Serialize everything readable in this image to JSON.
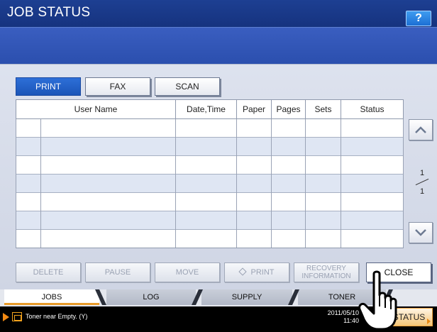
{
  "header": {
    "title": "JOB STATUS",
    "help_label": "?"
  },
  "tabs": [
    {
      "label": "PRINT",
      "active": true
    },
    {
      "label": "FAX",
      "active": false
    },
    {
      "label": "SCAN",
      "active": false
    }
  ],
  "table": {
    "columns": [
      "User Name",
      "Date,Time",
      "Paper",
      "Pages",
      "Sets",
      "Status"
    ],
    "rows": [
      [
        "",
        "",
        "",
        "",
        "",
        "",
        ""
      ],
      [
        "",
        "",
        "",
        "",
        "",
        "",
        ""
      ],
      [
        "",
        "",
        "",
        "",
        "",
        "",
        ""
      ],
      [
        "",
        "",
        "",
        "",
        "",
        "",
        ""
      ],
      [
        "",
        "",
        "",
        "",
        "",
        "",
        ""
      ],
      [
        "",
        "",
        "",
        "",
        "",
        "",
        ""
      ],
      [
        "",
        "",
        "",
        "",
        "",
        "",
        ""
      ]
    ]
  },
  "pagination": {
    "current": "1",
    "total": "1"
  },
  "actions": {
    "delete": "DELETE",
    "pause": "PAUSE",
    "move": "MOVE",
    "print": "PRINT",
    "recovery_line1": "RECOVERY",
    "recovery_line2": "INFORMATION",
    "close": "CLOSE"
  },
  "bottom_tabs": [
    {
      "label": "JOBS",
      "active": true
    },
    {
      "label": "LOG",
      "active": false
    },
    {
      "label": "SUPPLY",
      "active": false
    },
    {
      "label": "TONER",
      "active": false
    }
  ],
  "status_bar": {
    "message": "Toner near Empty. (Y)",
    "date": "2011/05/10",
    "time": "11:40",
    "status_button": "STATUS"
  },
  "icons": {
    "help": "question-icon",
    "scroll_up": "chevron-up-icon",
    "scroll_down": "chevron-down-icon",
    "print_action": "diamond-icon",
    "status_alert": "play-arrow-icon",
    "toner": "toner-icon",
    "pointer": "hand-pointer-icon"
  },
  "colors": {
    "title_bar": "#1d3f92",
    "message_bar": "#2b4fae",
    "active_tab": "#1b55b8",
    "tab_highlight": "#e89b2a",
    "status_button": "#f4c577"
  }
}
